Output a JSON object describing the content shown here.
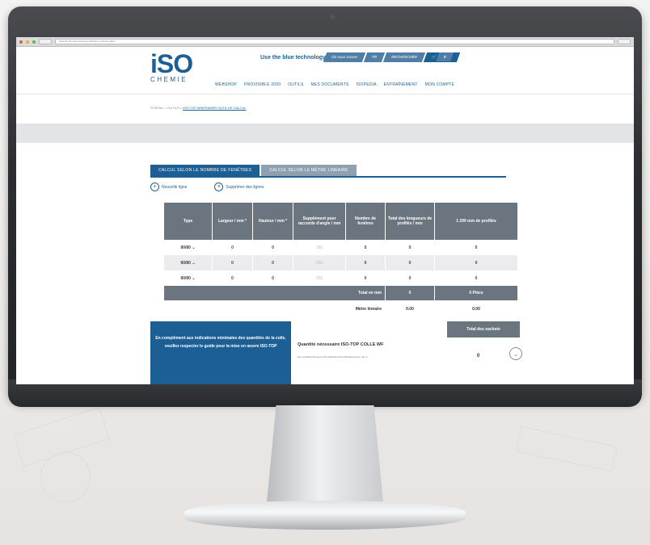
{
  "browser": {
    "url": "www.iso-chemie.de/iso-top-winframer-outil-de-calcul"
  },
  "header": {
    "logo_mark": "iSO",
    "logo_sub": "CHEMIE",
    "tagline": "Use the blue technology.",
    "top_links": [
      "Où nous trouver",
      "FR",
      "RECHERCHER",
      "0"
    ],
    "nav": [
      "WEBSHOP",
      "PROVISIBLE 2020",
      "OUTILS",
      "MES DOCUMENTS",
      "ISOPEDIA",
      "ENTRAÎNEMENT",
      "MON COMPTE"
    ]
  },
  "breadcrumb": {
    "prefix": "PORTAIL > OUTILS > ",
    "current": "ISO-TOP WINFRAMER OUTIL DE CALCUL"
  },
  "calculator": {
    "tabs": [
      "CALCUL SELON LE NOMBRE DE FENÊTRES",
      "CALCUL SELON LE MÈTRE LINÉAIRE"
    ],
    "add_line": "Nouvelle ligne",
    "delete_lines": "Supprimer des lignes",
    "columns": [
      "Type",
      "Largeur / mm *",
      "Hauteur / mm *",
      "Supplément pour raccords d'angle / mm",
      "Nombre de fenêtres",
      "Total des longueurs de profilés / mm",
      "1 200 mm de profilés"
    ],
    "rows": [
      {
        "type": "80/80 ⌄",
        "largeur": "0",
        "hauteur": "0",
        "supplement": "330",
        "nombre": "0",
        "total": "0",
        "profiles": "0"
      },
      {
        "type": "80/80 ⌄",
        "largeur": "0",
        "hauteur": "0",
        "supplement": "330",
        "nombre": "0",
        "total": "0",
        "profiles": "0"
      },
      {
        "type": "80/80 ⌄",
        "largeur": "0",
        "hauteur": "0",
        "supplement": "330",
        "nombre": "0",
        "total": "0",
        "profiles": "0"
      }
    ],
    "total_label": "Total en mm",
    "total_value": "0",
    "total_piece": "0 Pièce",
    "metre_label": "Mètre linéaire",
    "metre_value": "0.00",
    "metre_piece": "0.00",
    "note": "En complément aux indications minimales des quantités de la colle, veuillez respecter le guide pour la mise en œuvre ISO-TOP",
    "quantity_label": "Quantité nécessaire ISO-TOP COLLE WF",
    "quantity_sub": "Die ermittelte Menge ist die kalkulatorische Mindestmenge, die in",
    "sachets_label": "Total des sachets",
    "sachets_value": "0"
  }
}
